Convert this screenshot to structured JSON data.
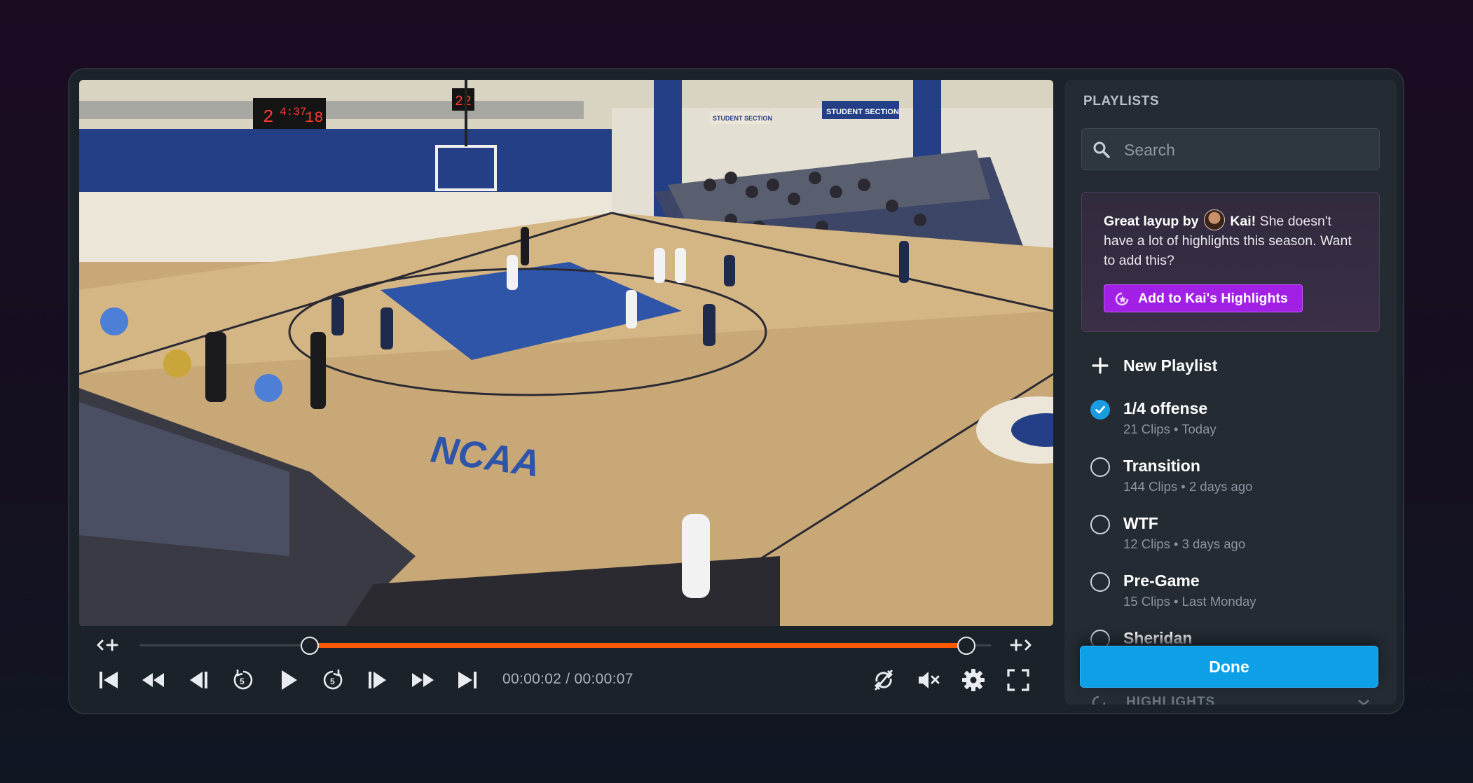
{
  "player": {
    "time_display": "00:00:02 / 00:00:07",
    "trim_start_fraction": 0.2,
    "trim_end_fraction": 0.97,
    "colors": {
      "accent": "#ff5a00"
    },
    "controls": [
      "skip-start-icon",
      "rewind-icon",
      "step-back-icon",
      "replay-5-icon",
      "play-icon",
      "forward-5-icon",
      "step-forward-icon",
      "fast-forward-icon",
      "skip-end-icon",
      "loop-off-icon",
      "volume-muted-icon",
      "settings-gear-icon",
      "fullscreen-icon"
    ],
    "scene": {
      "scoreboard_home": "2",
      "scoreboard_clock": "4:37",
      "scoreboard_away": "18",
      "shot_clock": "22",
      "floor_logo": "NCAA",
      "banner_student_section_left": "STUDENT SECTION",
      "banner_student_section_right": "STUDENT SECTION"
    }
  },
  "panel": {
    "title": "PLAYLISTS",
    "search_placeholder": "Search",
    "suggestion": {
      "lead": "Great layup by",
      "player": "Kai!",
      "rest": "She doesn't have a lot of highlights this season. Want to add this?",
      "button": "Add to Kai's Highlights",
      "color": "#a21fe6"
    },
    "new_playlist": "New Playlist",
    "playlists": [
      {
        "name": "1/4 offense",
        "meta": "21 Clips • Today",
        "checked": true
      },
      {
        "name": "Transition",
        "meta": "144 Clips • 2 days ago",
        "checked": false
      },
      {
        "name": "WTF",
        "meta": "12 Clips • 3 days ago",
        "checked": false
      },
      {
        "name": "Pre-Game",
        "meta": "15 Clips • Last Monday",
        "checked": false
      },
      {
        "name": "Sheridan",
        "meta": "",
        "checked": false
      }
    ],
    "done": "Done",
    "peek_section": "HIGHLIGHTS",
    "colors": {
      "done": "#0ea0e6",
      "check": "#1a9ce0"
    }
  }
}
